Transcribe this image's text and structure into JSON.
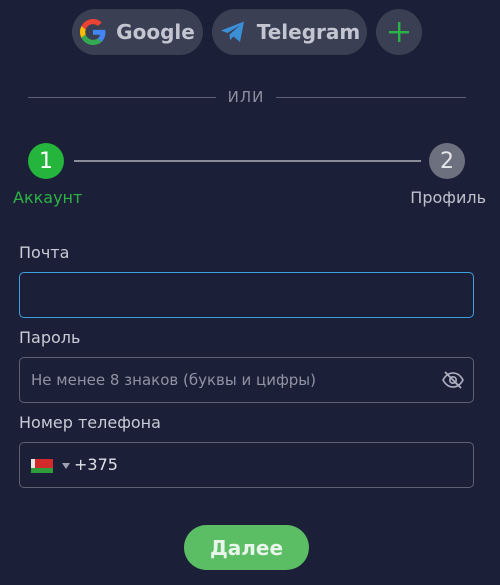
{
  "social": {
    "google_label": "Google",
    "telegram_label": "Telegram",
    "add_icon": "plus-icon"
  },
  "divider": {
    "text": "ИЛИ"
  },
  "stepper": {
    "steps": [
      {
        "number": "1",
        "label": "Аккаунт",
        "state": "active"
      },
      {
        "number": "2",
        "label": "Профиль",
        "state": "inactive"
      }
    ]
  },
  "form": {
    "email": {
      "label": "Почта",
      "value": "",
      "placeholder": ""
    },
    "password": {
      "label": "Пароль",
      "placeholder": "Не менее 8 знаков (буквы и цифры)"
    },
    "phone": {
      "label": "Номер телефона",
      "country_flag": "belarus-flag",
      "code": "+375"
    }
  },
  "submit": {
    "label": "Далее"
  },
  "colors": {
    "background": "#1b1f37",
    "accent_green": "#25b43c",
    "button_green": "#5bbd64",
    "focus_blue": "#3fa0de"
  }
}
